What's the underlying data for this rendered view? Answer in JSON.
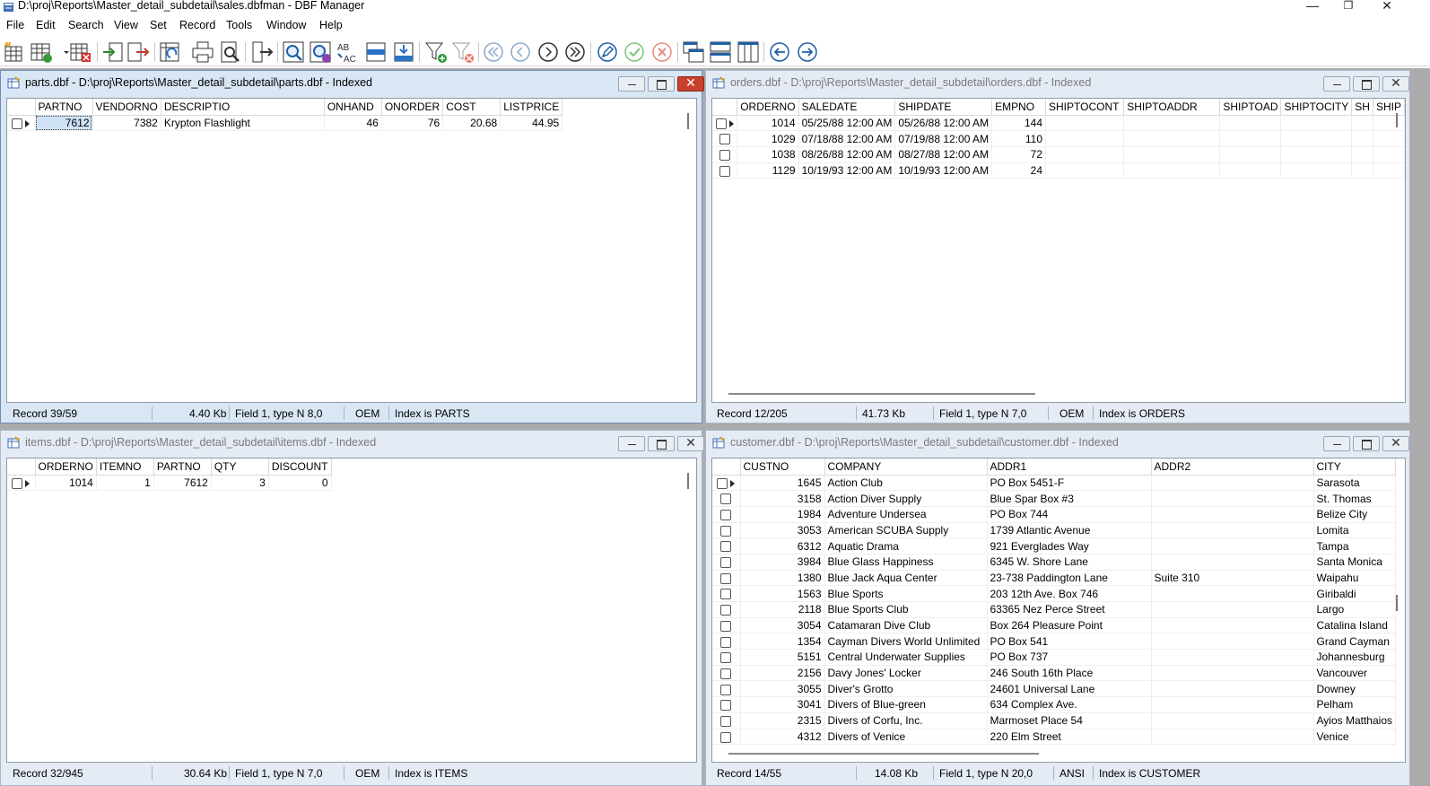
{
  "app": {
    "title": "D:\\proj\\Reports\\Master_detail_subdetail\\sales.dbfman - DBF Manager",
    "min_label": "—",
    "max_label": "❐",
    "close_label": "✕"
  },
  "menu": [
    "File",
    "Edit",
    "Search",
    "View",
    "Set",
    "Record",
    "Tools",
    "Window",
    "Help"
  ],
  "toolbar": {
    "icons": [
      "new-table-icon",
      "table-structure-icon",
      "delete-table-icon",
      "import-icon",
      "export-icon",
      "reload-icon",
      "print-icon",
      "print-preview-icon",
      "exit-icon",
      "find-icon",
      "find-next-icon",
      "replace-icon",
      "go-to-record-icon",
      "append-icon",
      "filter-add-icon",
      "filter-remove-icon",
      "first-record-icon",
      "prior-record-icon",
      "next-record-icon",
      "last-record-icon",
      "edit-record-icon",
      "post-record-icon",
      "cancel-record-icon",
      "cascade-windows-icon",
      "tile-horizontal-icon",
      "tile-vertical-icon",
      "back-icon",
      "forward-icon"
    ]
  },
  "windows": {
    "parts": {
      "title": "parts.dbf - D:\\proj\\Reports\\Master_detail_subdetail\\parts.dbf - Indexed",
      "columns": [
        "PARTNO",
        "VENDORNO",
        "DESCRIPTIO",
        "ONHAND",
        "ONORDER",
        "COST",
        "LISTPRICE"
      ],
      "rows": [
        [
          "7612",
          "7382",
          "Krypton Flashlight",
          "46",
          "76",
          "20.68",
          "44.95"
        ]
      ],
      "status": {
        "record": "Record 39/59",
        "size": "4.40 Kb",
        "field": "Field 1, type N 8,0",
        "charset": "OEM",
        "index": "Index is PARTS"
      }
    },
    "orders": {
      "title": "orders.dbf - D:\\proj\\Reports\\Master_detail_subdetail\\orders.dbf - Indexed",
      "columns": [
        "ORDERNO",
        "SALEDATE",
        "SHIPDATE",
        "EMPNO",
        "SHIPTOCONT",
        "SHIPTOADDR",
        "SHIPTOAD",
        "SHIPTOCITY",
        "SH",
        "SHIP"
      ],
      "rows": [
        [
          "1014",
          "05/25/88 12:00 AM",
          "05/26/88 12:00 AM",
          "144"
        ],
        [
          "1029",
          "07/18/88 12:00 AM",
          "07/19/88 12:00 AM",
          "110"
        ],
        [
          "1038",
          "08/26/88 12:00 AM",
          "08/27/88 12:00 AM",
          "72"
        ],
        [
          "1129",
          "10/19/93 12:00 AM",
          "10/19/93 12:00 AM",
          "24"
        ]
      ],
      "status": {
        "record": "Record 12/205",
        "size": "41.73 Kb",
        "field": "Field 1, type N 7,0",
        "charset": "OEM",
        "index": "Index is ORDERS"
      }
    },
    "items": {
      "title": "items.dbf - D:\\proj\\Reports\\Master_detail_subdetail\\items.dbf - Indexed",
      "columns": [
        "ORDERNO",
        "ITEMNO",
        "PARTNO",
        "QTY",
        "DISCOUNT"
      ],
      "rows": [
        [
          "1014",
          "1",
          "7612",
          "3",
          "0"
        ]
      ],
      "status": {
        "record": "Record 32/945",
        "size": "30.64 Kb",
        "field": "Field 1, type N 7,0",
        "charset": "OEM",
        "index": "Index is ITEMS"
      }
    },
    "customer": {
      "title": "customer.dbf - D:\\proj\\Reports\\Master_detail_subdetail\\customer.dbf - Indexed",
      "columns": [
        "CUSTNO",
        "COMPANY",
        "ADDR1",
        "ADDR2",
        "CITY"
      ],
      "rows": [
        [
          "1645",
          "Action Club",
          "PO Box 5451-F",
          "",
          "Sarasota"
        ],
        [
          "3158",
          "Action Diver Supply",
          "Blue Spar Box #3",
          "",
          "St. Thomas"
        ],
        [
          "1984",
          "Adventure Undersea",
          "PO Box 744",
          "",
          "Belize City"
        ],
        [
          "3053",
          "American SCUBA Supply",
          "1739 Atlantic Avenue",
          "",
          "Lomita"
        ],
        [
          "6312",
          "Aquatic Drama",
          "921 Everglades Way",
          "",
          "Tampa"
        ],
        [
          "3984",
          "Blue Glass Happiness",
          "6345 W. Shore Lane",
          "",
          "Santa Monica"
        ],
        [
          "1380",
          "Blue Jack Aqua Center",
          "23-738 Paddington Lane",
          "Suite 310",
          "Waipahu"
        ],
        [
          "1563",
          "Blue Sports",
          "203 12th Ave. Box 746",
          "",
          "Giribaldi"
        ],
        [
          "2118",
          "Blue Sports Club",
          "63365 Nez Perce Street",
          "",
          "Largo"
        ],
        [
          "3054",
          "Catamaran Dive Club",
          "Box 264 Pleasure Point",
          "",
          "Catalina Island"
        ],
        [
          "1354",
          "Cayman Divers World Unlimited",
          "PO Box 541",
          "",
          "Grand Cayman"
        ],
        [
          "5151",
          "Central Underwater Supplies",
          "PO Box 737",
          "",
          "Johannesburg"
        ],
        [
          "2156",
          "Davy Jones' Locker",
          "246 South 16th Place",
          "",
          "Vancouver"
        ],
        [
          "3055",
          "Diver's Grotto",
          "24601 Universal Lane",
          "",
          "Downey"
        ],
        [
          "3041",
          "Divers of Blue-green",
          "634 Complex Ave.",
          "",
          "Pelham"
        ],
        [
          "2315",
          "Divers of Corfu, Inc.",
          "Marmoset Place 54",
          "",
          "Ayios Matthaios"
        ],
        [
          "4312",
          "Divers of Venice",
          "220 Elm Street",
          "",
          "Venice"
        ]
      ],
      "status": {
        "record": "Record 14/55",
        "size": "14.08 Kb",
        "field": "Field 1, type N 20,0",
        "charset": "ANSI",
        "index": "Index is CUSTOMER"
      }
    }
  }
}
